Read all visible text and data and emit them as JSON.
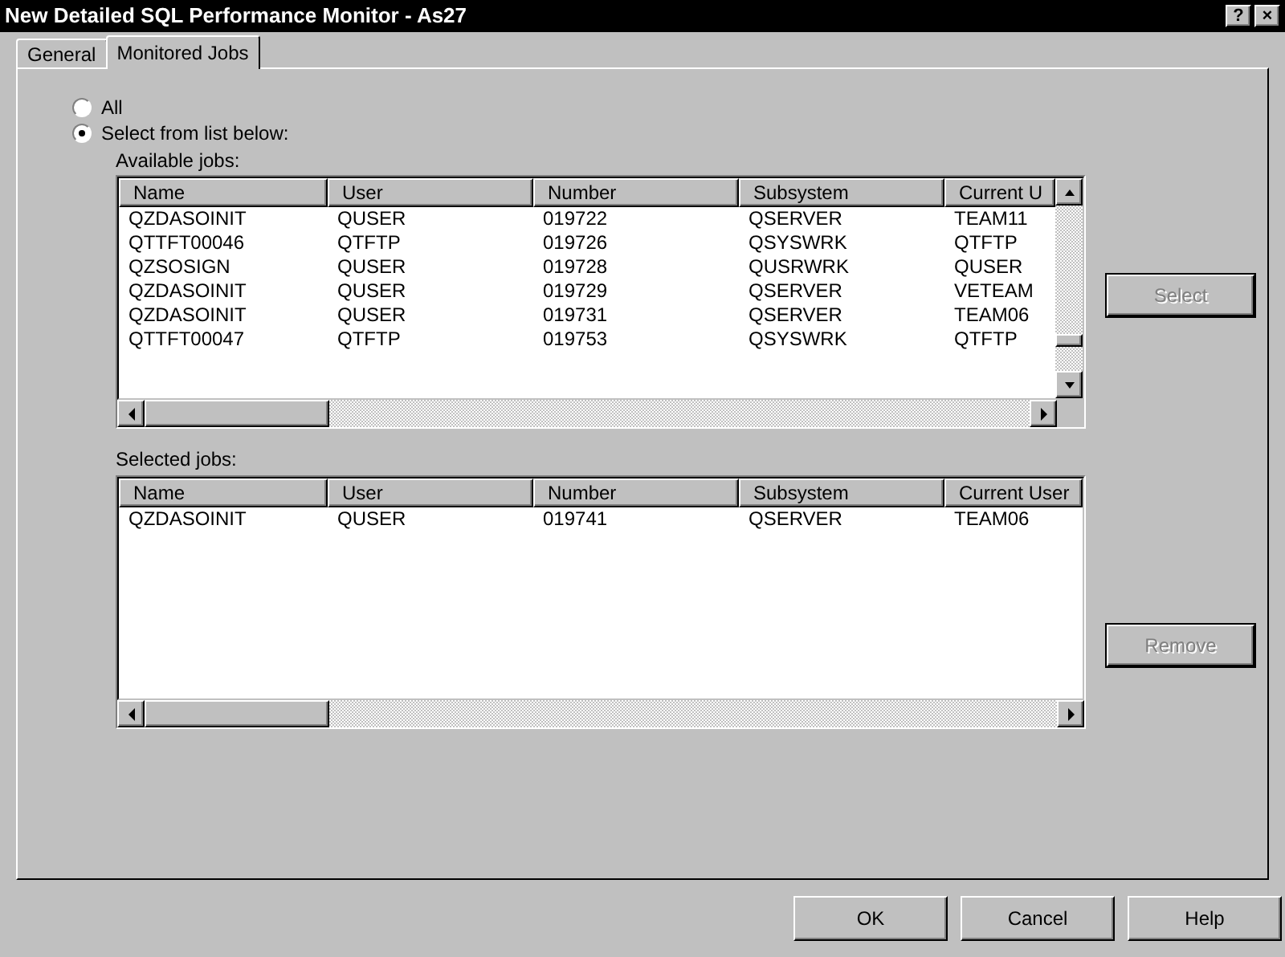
{
  "window": {
    "title": "New Detailed SQL Performance Monitor - As27",
    "title_buttons": [
      "?",
      "×"
    ]
  },
  "tabs": [
    {
      "label": "General",
      "selected": false
    },
    {
      "label": "Monitored Jobs",
      "selected": true
    }
  ],
  "job_choice": [
    {
      "label": "All",
      "selected": false
    },
    {
      "label": "Select from list below:",
      "selected": true
    }
  ],
  "available_jobs": {
    "label": "Available jobs:",
    "columns": [
      "Name",
      "User",
      "Number",
      "Subsystem",
      "Current U"
    ],
    "rows": [
      [
        "QZDASOINIT",
        "QUSER",
        "019722",
        "QSERVER",
        "TEAM11"
      ],
      [
        "QTTFT00046",
        "QTFTP",
        "019726",
        "QSYSWRK",
        "QTFTP"
      ],
      [
        "QZSOSIGN",
        "QUSER",
        "019728",
        "QUSRWRK",
        "QUSER"
      ],
      [
        "QZDASOINIT",
        "QUSER",
        "019729",
        "QSERVER",
        "VETEAM"
      ],
      [
        "QZDASOINIT",
        "QUSER",
        "019731",
        "QSERVER",
        "TEAM06"
      ],
      [
        "QTTFT00047",
        "QTFTP",
        "019753",
        "QSYSWRK",
        "QTFTP"
      ]
    ],
    "button": {
      "label": "Select",
      "disabled": true
    }
  },
  "selected_jobs": {
    "label": "Selected jobs:",
    "columns": [
      "Name",
      "User",
      "Number",
      "Subsystem",
      "Current User"
    ],
    "rows": [
      [
        "QZDASOINIT",
        "QUSER",
        "019741",
        "QSERVER",
        "TEAM06"
      ]
    ],
    "button": {
      "label": "Remove",
      "disabled": true
    }
  },
  "buttons": [
    "OK",
    "Cancel",
    "Help"
  ]
}
